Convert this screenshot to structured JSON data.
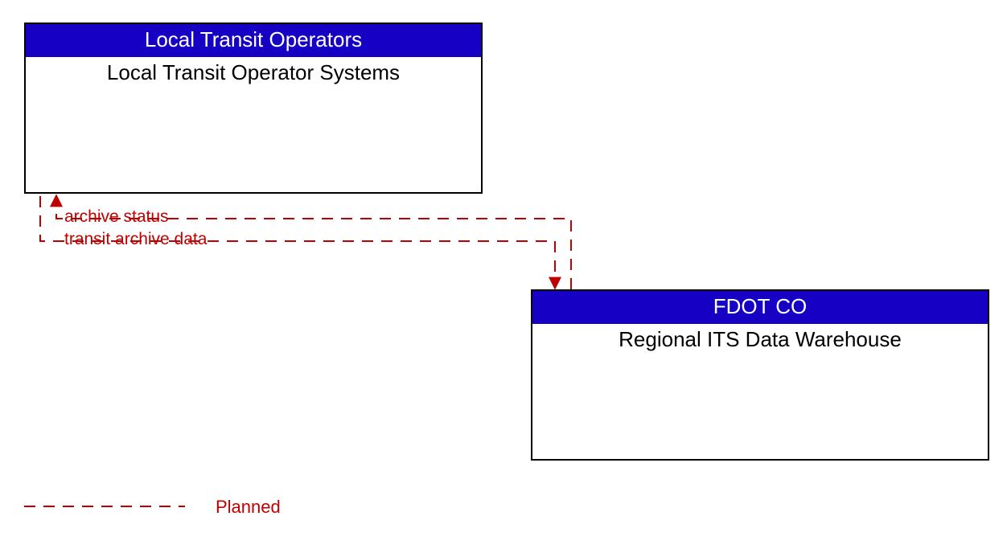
{
  "boxes": {
    "topLeft": {
      "header": "Local Transit Operators",
      "body": "Local Transit Operator Systems"
    },
    "bottomRight": {
      "header": "FDOT CO",
      "body": "Regional ITS Data Warehouse"
    }
  },
  "flows": {
    "archiveStatus": "archive status",
    "transitArchiveData": "transit archive data"
  },
  "legend": {
    "planned": "Planned"
  },
  "colors": {
    "headerBg": "#1500c3",
    "planned": "#c00000"
  }
}
